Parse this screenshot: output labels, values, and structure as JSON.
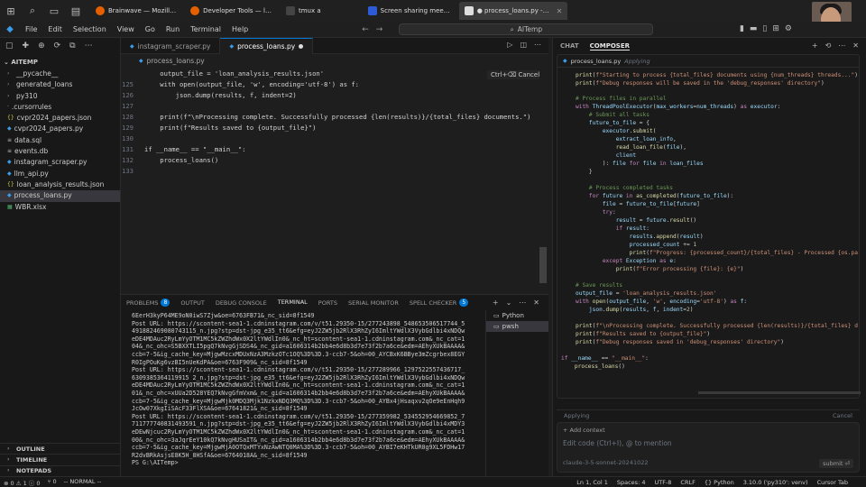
{
  "taskbar": {
    "tabs": [
      {
        "label": "Brainwave — Mozill…",
        "color": "#e66000"
      },
      {
        "label": "Developer Tools — l…",
        "color": "#e66000"
      },
      {
        "label": "tmux a",
        "color": "#444444"
      },
      {
        "label": "Screen sharing mee…",
        "color": "#2d5bd7"
      },
      {
        "label": "● process_loans.py -…",
        "color": "#2b2b2b"
      }
    ]
  },
  "menu": {
    "items": [
      "File",
      "Edit",
      "Selection",
      "View",
      "Go",
      "Run",
      "Terminal",
      "Help"
    ],
    "search_label": "AITemp"
  },
  "explorer": {
    "section": "AITEMP",
    "items": [
      {
        "label": "__pycache__",
        "kind": "folder"
      },
      {
        "label": "generated_loans",
        "kind": "folder"
      },
      {
        "label": "py310",
        "kind": "folder"
      },
      {
        "label": ".cursorrules",
        "kind": "file"
      },
      {
        "label": "cvpr2024_papers.json",
        "kind": "json"
      },
      {
        "label": "cvpr2024_papers.py",
        "kind": "py"
      },
      {
        "label": "data.sql",
        "kind": "db"
      },
      {
        "label": "events.db",
        "kind": "db"
      },
      {
        "label": "instagram_scraper.py",
        "kind": "py"
      },
      {
        "label": "llm_api.py",
        "kind": "py"
      },
      {
        "label": "loan_analysis_results.json",
        "kind": "json"
      },
      {
        "label": "process_loans.py",
        "kind": "py",
        "selected": true
      },
      {
        "label": "WBR.xlsx",
        "kind": "xlsx"
      }
    ],
    "bottom_sections": [
      "OUTLINE",
      "TIMELINE",
      "NOTEPADS"
    ]
  },
  "editor": {
    "tabs": [
      {
        "label": "instagram_scraper.py",
        "active": false
      },
      {
        "label": "process_loans.py",
        "active": true
      }
    ],
    "breadcrumb": "process_loans.py",
    "accept_hint": "Ctrl+⌫ Cancel",
    "lines": [
      {
        "n": "",
        "text": "    output_file = 'loan_analysis_results.json'"
      },
      {
        "n": "125",
        "text": "    with open(output_file, 'w', encoding='utf-8') as f:"
      },
      {
        "n": "126",
        "text": "        json.dump(results, f, indent=2)"
      },
      {
        "n": "127",
        "text": ""
      },
      {
        "n": "128",
        "text": "    print(f\"\\nProcessing complete. Successfully processed {len(results)}/{total_files} documents.\")"
      },
      {
        "n": "129",
        "text": "    print(f\"Results saved to {output_file}\")"
      },
      {
        "n": "130",
        "text": ""
      },
      {
        "n": "131",
        "text": "if __name__ == \"__main__\":"
      },
      {
        "n": "132",
        "text": "    process_loans()"
      },
      {
        "n": "133",
        "text": ""
      }
    ]
  },
  "panel": {
    "tabs": [
      {
        "label": "PROBLEMS",
        "badge": "8"
      },
      {
        "label": "OUTPUT",
        "badge": ""
      },
      {
        "label": "DEBUG CONSOLE",
        "badge": ""
      },
      {
        "label": "TERMINAL",
        "badge": "",
        "active": true
      },
      {
        "label": "PORTS",
        "badge": ""
      },
      {
        "label": "SERIAL MONITOR",
        "badge": ""
      },
      {
        "label": "SPELL CHECKER",
        "badge": "5"
      }
    ],
    "terminal_list": [
      "Python",
      "pwsh"
    ],
    "terminal_lines": [
      "6EerH3kyP64ME9oN0iwS7Zjw&oe=6763FB71&_nc_sid=8f1549",
      "Post URL: https://scontent-sea1-1.cdninstagram.com/v/t51.29350-15/277243898_548653506517744_5",
      "491882469080743115_n.jpg?stp=dst-jpg_e35_tt6&efg=eyJ2ZW5jb2RlX3RhZyI6ImltYWdlX3VybGdlbi4xNDQw",
      "eDE4MDAuc2RyLmYyOTM1MC5kZWZhdWx0X2ltYWdlIn0&_nc_ht=scontent-sea1-1.cdninstagram.com&_nc_cat=1",
      "04&_nc_ohc=S5BXXTLI5pgQ7kNvgGjSDS4&_nc_gid=a1606314b2bb4e6d8b3d7e73f2b7a6ce&edm=AEhyXUkBAAAA&",
      "ccb=7-5&ig_cache_key=MjgwMzcxMDUxNzA3MzkzOTc1OQ%3D%3D.3-ccb7-5&oh=00_AYCBxK6BBye3mZcgrbex8EGY",
      "R0IgPOuKg6vzBI5nUeKdPA&oe=6763F909&_nc_sid=8f1549",
      "Post URL: https://scontent-sea1-1.cdninstagram.com/v/t51.29350-15/277289966_1297522557436717_",
      "6309385364119915 2_n.jpg?stp=dst-jpg_e35_tt6&efg=eyJ2ZW5jb2RlX3RhZyI6ImltYWdlX3VybGdlbi4xNDQw",
      "eDE4MDAuc2RyLmYyOTM1MC5kZWZhdWx0X2ltYWdlIn0&_nc_ht=scontent-sea1-1.cdninstagram.com&_nc_cat=1",
      "01&_nc_ohc=xUUa2D528YEQ7kNvgGfmVxm&_nc_gid=a1606314b2bb4e6d8b3d7e73f2b7a6ce&edm=AEhyXUkBAAAA&",
      "ccb=7-5&ig_cache_key=MjgwMjk0MDQ3Mjk1NzkxNDQ3MQ%3D%3D.3-ccb7-5&oh=00_AYBx4jHsaqxv2qOe9eEnHqh9",
      "JcOw07XkgIiSAcF33FlXSA&oe=67641821&_nc_sid=8f1549",
      "Post URL: https://scontent-sea1-1.cdninstagram.com/v/t51.29350-15/277359982_534552954669852_7",
      "711777740831493591_n.jpg?stp=dst-jpg_e35_tt6&efg=eyJ2ZW5jb2RlX3RhZyI6ImltYWdlX3VybGdlbi4xMDY3",
      "eDEwNjcuc2RyLmYyOTM1MC5kZWZhdWx0X2ltYWdlIn0&_nc_ht=scontent-sea1-1.cdninstagram.com&_nc_cat=1",
      "00&_nc_ohc=3aJqrEeY10kQ7kNvgHUSaIT&_nc_gid=a1606314b2bb4e6d8b3d7e73f2b7a6ce&edm=AEhyXUkBAAAA&",
      "ccb=7-5&ig_cache_key=MjgwMjA0OTQxMTYxNzAwNTQ0MA%3D%3D.3-ccb7-5&oh=00_AYBI7eKHTkUR0g9XL5FDHw17",
      "R2dvBRkAsjsE8K5H_8HSfA&oe=6764018A&_nc_sid=8f1549",
      "PS G:\\AITemp> "
    ]
  },
  "ai": {
    "tabs": [
      "CHAT",
      "COMPOSER"
    ],
    "active_tab": "COMPOSER",
    "file": "process_loans.py",
    "file_status": "Applying",
    "applying_label": "Applying",
    "cancel_label": "Cancel",
    "add_context": "+ Add context",
    "placeholder": "Edit code (Ctrl+I), @ to mention",
    "model": "claude-3-5-sonnet-20241022",
    "submit": "submit ⏎"
  },
  "status": {
    "left": [
      "⊗ 0 ⚠ 1 ⓘ 0",
      "⑂ 0",
      "-- NORMAL --"
    ],
    "right": [
      "Ln 1, Col 1",
      "Spaces: 4",
      "UTF-8",
      "CRLF",
      "{} Python",
      "3.10.0 ('py310': venv)",
      "Cursor Tab"
    ]
  }
}
